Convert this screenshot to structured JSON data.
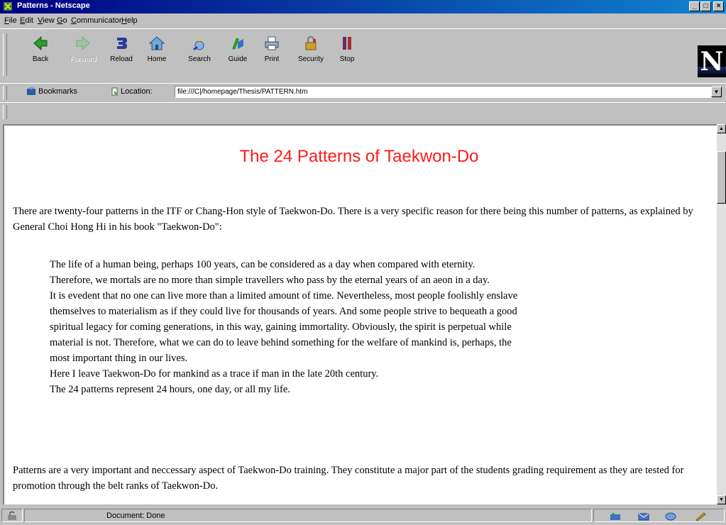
{
  "window": {
    "title": "Patterns - Netscape",
    "buttons": {
      "minimize": "_",
      "maximize": "□",
      "close": "×"
    }
  },
  "menu": [
    "File",
    "Edit",
    "View",
    "Go",
    "Communicator",
    "Help"
  ],
  "toolbar": {
    "back": "Back",
    "forward": "Forward",
    "reload": "Reload",
    "home": "Home",
    "search": "Search",
    "guide": "Guide",
    "print": "Print",
    "security": "Security",
    "stop": "Stop"
  },
  "location_bar": {
    "bookmarks": "Bookmarks",
    "location_label": "Location:",
    "url": "file:///C|/homepage/Thesis/PATTERN.htm"
  },
  "logo": "N",
  "page": {
    "title": "The 24 Patterns of Taekwon-Do",
    "intro": "There are twenty-four patterns in the ITF or Chang-Hon style of Taekwon-Do. There is a very specific reason for there being this number of patterns, as explained by General Choi Hong Hi in his book \"Taekwon-Do\":",
    "quote_lines": [
      "The life of a human being, perhaps 100 years, can be considered as a day when compared with eternity.",
      "Therefore, we mortals are no more than simple travellers who pass by the eternal years of an aeon in a day.",
      "It is evedent that no one can live more than a limited amount of time. Nevertheless, most people foolishly enslave",
      "themselves to materialism as if they could live for thousands of years. And some people strive to bequeath a good",
      "spiritual legacy for coming generations, in this way, gaining immortality. Obviously, the spirit is perpetual while",
      "material is not. Therefore, what we can do to leave behind something for the welfare of mankind is, perhaps, the",
      "most important thing in our lives.",
      "Here I leave Taekwon-Do for mankind as a trace if man in the late 20th century.",
      "The 24 patterns represent 24 hours, one day, or all my life."
    ],
    "para2": "Patterns are a very important and neccessary aspect of Taekwon-Do training. They constitute a major part of the students grading requirement as they are tested for promotion through the belt ranks of Taekwon-Do."
  },
  "status": {
    "text": "Document: Done"
  }
}
